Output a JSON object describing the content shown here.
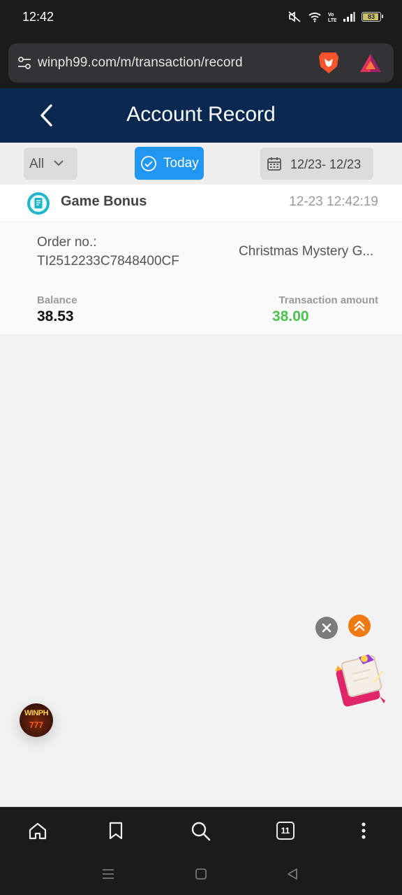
{
  "status_bar": {
    "time": "12:42",
    "battery": "83",
    "icons": [
      "mute-icon",
      "wifi-icon",
      "volte-icon",
      "signal-icon",
      "battery-icon"
    ]
  },
  "browser": {
    "url": "winph99.com/m/transaction/record",
    "tabs_count": "11"
  },
  "header": {
    "title": "Account Record"
  },
  "filters": {
    "type": "All",
    "today": "Today",
    "date_range": "12/23- 12/23"
  },
  "record": {
    "type": "Game Bonus",
    "timestamp": "12-23 12:42:19",
    "order_label": "Order no.:",
    "order_no": "TI2512233C7848400CF",
    "description": "Christmas Mystery G...",
    "balance_label": "Balance",
    "balance": "38.53",
    "amount_label": "Transaction amount",
    "amount": "38.00"
  },
  "badge": {
    "logo_text": "WINPH",
    "logo_sub": "777"
  },
  "colors": {
    "header": "#0b2850",
    "accent": "#2196f3",
    "amount": "#4cc24f",
    "scroll_top": "#f07a12"
  }
}
